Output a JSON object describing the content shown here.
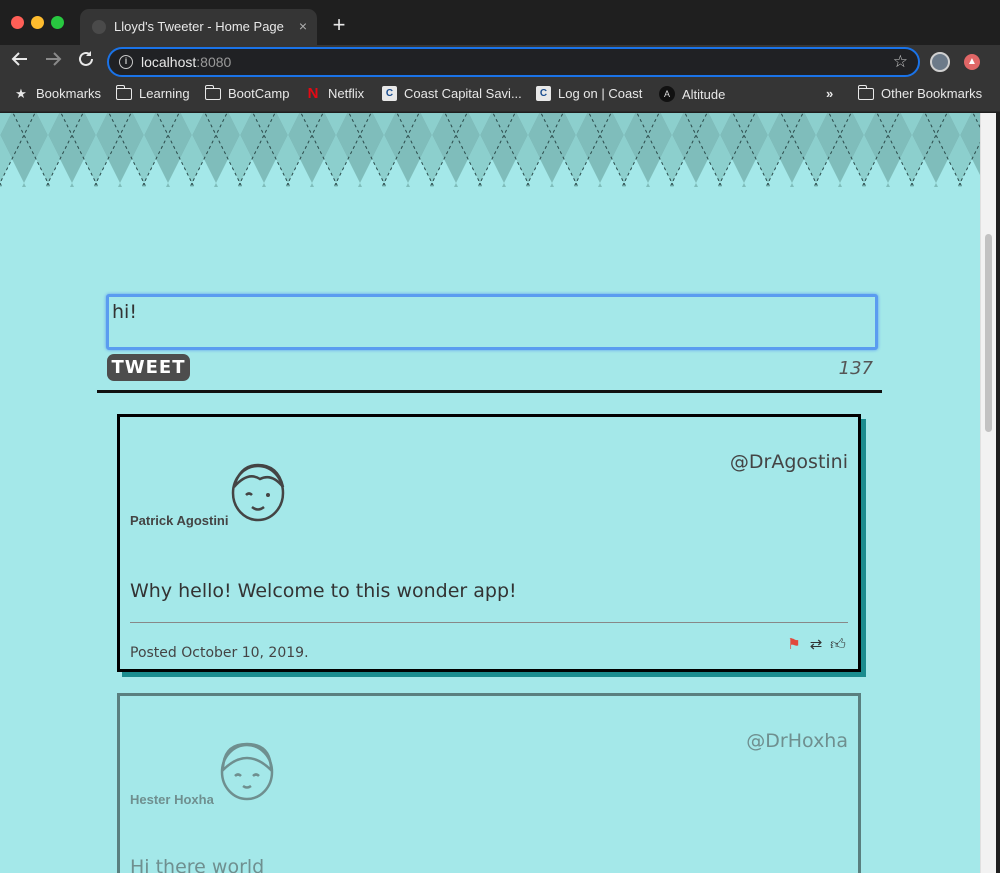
{
  "browser": {
    "tab_title": "Lloyd's Tweeter - Home Page",
    "tab_close": "×",
    "new_tab": "+",
    "url_host": "localhost",
    "url_port": ":8080",
    "bookmarks": [
      {
        "label": "Bookmarks",
        "icon": "star-icon"
      },
      {
        "label": "Learning",
        "icon": "folder-icon"
      },
      {
        "label": "BootCamp",
        "icon": "folder-icon"
      },
      {
        "label": "Netflix",
        "icon": "netflix-icon"
      },
      {
        "label": "Coast Capital Savi...",
        "icon": "coast-capital-icon"
      },
      {
        "label": "Log on | Coast",
        "icon": "coast-capital-icon"
      },
      {
        "label": "Altitude",
        "icon": "altitude-icon"
      }
    ],
    "more_bookmarks": "»",
    "other_bookmarks": "Other Bookmarks"
  },
  "compose": {
    "value": "hi!",
    "tweet_button": "TWEET",
    "char_count": "137"
  },
  "tweets": [
    {
      "author": "Patrick Agostini",
      "handle": "@DrAgostini",
      "content": "Why hello! Welcome to this wonder app!",
      "posted": "Posted October 10, 2019."
    },
    {
      "author": "Hester Hoxha",
      "handle": "@DrHoxha",
      "content": "Hi there world"
    }
  ],
  "colors": {
    "page_background": "#a4e8e9",
    "tweet_shadow": "#1b8c8e",
    "flag": "#e2483c"
  }
}
